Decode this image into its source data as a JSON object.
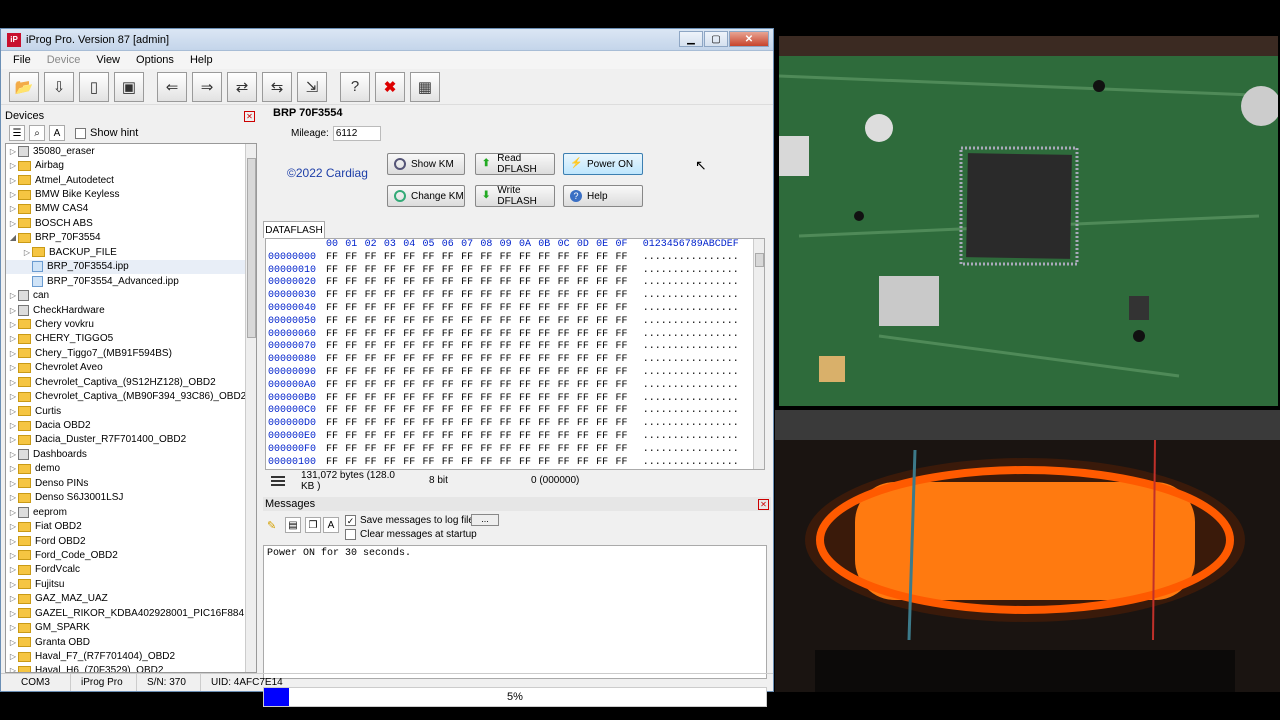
{
  "window": {
    "title": "iProg Pro. Version 87 [admin]",
    "app_icon": "iP"
  },
  "menu": [
    {
      "label": "File",
      "disabled": false
    },
    {
      "label": "Device",
      "disabled": true
    },
    {
      "label": "View",
      "disabled": false
    },
    {
      "label": "Options",
      "disabled": false
    },
    {
      "label": "Help",
      "disabled": false
    }
  ],
  "devices": {
    "title": "Devices",
    "show_hint": "Show hint",
    "items": [
      {
        "label": "35080_eraser",
        "type": "chip",
        "indent": 0
      },
      {
        "label": "Airbag",
        "type": "folder",
        "indent": 0
      },
      {
        "label": "Atmel_Autodetect",
        "type": "folder",
        "indent": 0
      },
      {
        "label": "BMW Bike Keyless",
        "type": "folder",
        "indent": 0
      },
      {
        "label": "BMW CAS4",
        "type": "folder",
        "indent": 0
      },
      {
        "label": "BOSCH ABS",
        "type": "folder",
        "indent": 0
      },
      {
        "label": "BRP_70F3554",
        "type": "folder",
        "indent": 0,
        "expanded": true
      },
      {
        "label": "BACKUP_FILE",
        "type": "folder",
        "indent": 1
      },
      {
        "label": "BRP_70F3554.ipp",
        "type": "file",
        "indent": 1,
        "selected": true
      },
      {
        "label": "BRP_70F3554_Advanced.ipp",
        "type": "file",
        "indent": 1
      },
      {
        "label": "can",
        "type": "chip",
        "indent": 0
      },
      {
        "label": "CheckHardware",
        "type": "chip",
        "indent": 0
      },
      {
        "label": "Chery vovkru",
        "type": "folder",
        "indent": 0
      },
      {
        "label": "CHERY_TIGGO5",
        "type": "folder",
        "indent": 0
      },
      {
        "label": "Chery_Tiggo7_(MB91F594BS)",
        "type": "folder",
        "indent": 0
      },
      {
        "label": "Chevrolet Aveo",
        "type": "folder",
        "indent": 0
      },
      {
        "label": "Chevrolet_Captiva_(9S12HZ128)_OBD2",
        "type": "folder",
        "indent": 0
      },
      {
        "label": "Chevrolet_Captiva_(MB90F394_93C86)_OBD2",
        "type": "folder",
        "indent": 0
      },
      {
        "label": "Curtis",
        "type": "folder",
        "indent": 0
      },
      {
        "label": "Dacia OBD2",
        "type": "folder",
        "indent": 0
      },
      {
        "label": "Dacia_Duster_R7F701400_OBD2",
        "type": "folder",
        "indent": 0
      },
      {
        "label": "Dashboards",
        "type": "chip",
        "indent": 0
      },
      {
        "label": "demo",
        "type": "folder",
        "indent": 0
      },
      {
        "label": "Denso PINs",
        "type": "folder",
        "indent": 0
      },
      {
        "label": "Denso S6J3001LSJ",
        "type": "folder",
        "indent": 0
      },
      {
        "label": "eeprom",
        "type": "chip",
        "indent": 0
      },
      {
        "label": "Fiat OBD2",
        "type": "folder",
        "indent": 0
      },
      {
        "label": "Ford OBD2",
        "type": "folder",
        "indent": 0
      },
      {
        "label": "Ford_Code_OBD2",
        "type": "folder",
        "indent": 0
      },
      {
        "label": "FordVcalc",
        "type": "folder",
        "indent": 0
      },
      {
        "label": "Fujitsu",
        "type": "folder",
        "indent": 0
      },
      {
        "label": "GAZ_MAZ_UAZ",
        "type": "folder",
        "indent": 0
      },
      {
        "label": "GAZEL_RIKOR_KDBA402928001_PIC16F884",
        "type": "folder",
        "indent": 0
      },
      {
        "label": "GM_SPARK",
        "type": "folder",
        "indent": 0
      },
      {
        "label": "Granta OBD",
        "type": "folder",
        "indent": 0
      },
      {
        "label": "Haval_F7_(R7F701404)_OBD2",
        "type": "folder",
        "indent": 0
      },
      {
        "label": "Haval_H6_(70F3529)_OBD2",
        "type": "folder",
        "indent": 0
      }
    ]
  },
  "device_panel": {
    "title": "BRP 70F3554",
    "mileage_label": "Mileage:",
    "mileage_value": "6112",
    "copyright": "©2022 Cardiag",
    "buttons": {
      "show_km": "Show KM",
      "change_km": "Change KM",
      "read_dflash": "Read DFLASH",
      "write_dflash": "Write DFLASH",
      "power_on": "Power ON",
      "help": "Help"
    }
  },
  "hex": {
    "tab": "DATAFLASH",
    "columns": [
      "00",
      "01",
      "02",
      "03",
      "04",
      "05",
      "06",
      "07",
      "08",
      "09",
      "0A",
      "0B",
      "0C",
      "0D",
      "0E",
      "0F"
    ],
    "ascii_header": "0123456789ABCDEF",
    "addresses": [
      "00000000",
      "00000010",
      "00000020",
      "00000030",
      "00000040",
      "00000050",
      "00000060",
      "00000070",
      "00000080",
      "00000090",
      "000000A0",
      "000000B0",
      "000000C0",
      "000000D0",
      "000000E0",
      "000000F0",
      "00000100"
    ],
    "fill_byte": "FF",
    "fill_ascii": "................",
    "info_size": "131,072 bytes (128.0 KB )",
    "info_bits": "8 bit",
    "info_pos": "0 (000000)"
  },
  "messages": {
    "title": "Messages",
    "save_log": "Save messages to log file",
    "save_log_checked": true,
    "browse": "...",
    "clear_startup": "Clear messages at startup",
    "clear_startup_checked": false,
    "text": "Power ON for 30 seconds."
  },
  "progress": {
    "value": 5,
    "label": "5%"
  },
  "status": {
    "port": "COM3",
    "device": "iProg Pro",
    "serial": "S/N: 370",
    "uid": "UID: 4AFC7E14"
  },
  "colors": {
    "accent": "#0000ff",
    "hex_blue": "#0022cc"
  }
}
